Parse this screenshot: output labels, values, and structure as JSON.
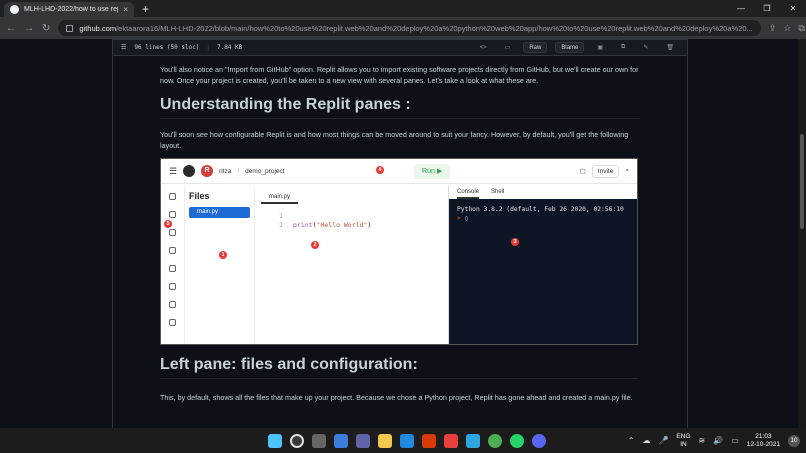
{
  "browser": {
    "tab_title": "MLH-LHD-2022/how to use repl",
    "tab_close": "×",
    "new_tab": "+",
    "win_min": "—",
    "win_max": "❐",
    "win_close": "✕",
    "url_host": "github.com",
    "url_path": "/ektaarora16/MLH-LHD-2022/blob/main/how%20to%20use%20replit.web%20and%20deploy%20a%20python%20web%20app/how%20to%20use%20replit.web%20and%20deploy%20a%20..."
  },
  "file_header": {
    "lines": "96 lines (50 sloc)",
    "size": "7.84 KB",
    "raw": "Raw",
    "blame": "Blame"
  },
  "article": {
    "para1": "You'll also notice an \"Import from GitHub\" option. Replit allows you to import existing software projects directly from GitHub, but we'll create our own for now. Once your project is created, you'll be taken to a new view with several panes. Let's take a look at what these are.",
    "h2_panes": "Understanding the Replit panes :",
    "para2": "You'll soon see how configurable Replit is and how most things can be moved around to suit your fancy. However, by default, you'll get the following layout.",
    "h2_left": "Left pane: files and configuration:",
    "para3": "This, by default, shows all the files that make up your project. Because we chose a Python project, Replit has gone ahead and created a main.py file."
  },
  "replit": {
    "user_initial": "R",
    "user": "ritza",
    "project": "demo_project",
    "crumb_sep": "/",
    "run": "Run ▶",
    "invite": "Invite",
    "files_title": "Files",
    "file_main": "main.py",
    "editor_tab": "main.py",
    "code_line1_no": "1",
    "code_line2_no": "2",
    "code_fn": "print",
    "code_open": "(",
    "code_str": "\"Hello World\"",
    "code_close": ")",
    "console_tab": "Console",
    "shell_tab": "Shell",
    "console_banner": "Python 3.8.2 (default, Feb 26 2020, 02:56:10",
    "prompt": ">",
    "badges": [
      "1",
      "2",
      "3",
      "4",
      "5"
    ]
  },
  "taskbar": {
    "lang_top": "ENG",
    "lang_bottom": "IN",
    "time": "21:03",
    "date": "12-10-2021",
    "notif": "10"
  }
}
